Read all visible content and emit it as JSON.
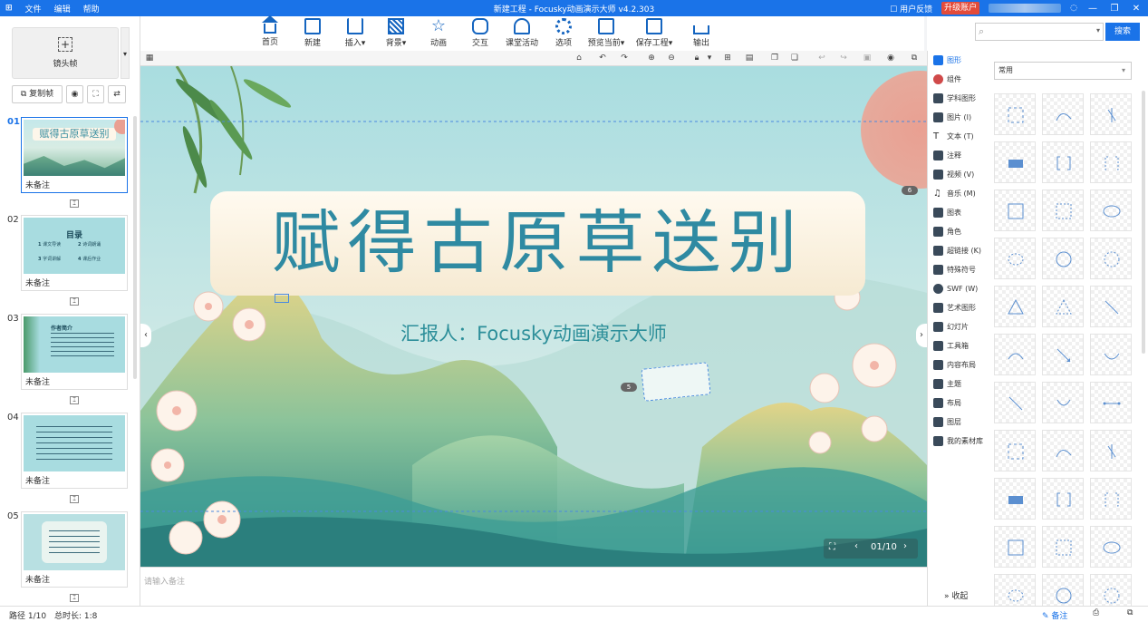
{
  "titlebar": {
    "menu": [
      "文件",
      "编辑",
      "帮助"
    ],
    "title": "新建工程 - Focusky动画演示大师  v4.2.303",
    "feedback": "用户反馈",
    "upgrade": "升级账户"
  },
  "toolbar": {
    "items": [
      "首页",
      "新建",
      "插入",
      "背景",
      "动画",
      "交互",
      "课堂活动",
      "选项",
      "预览当前",
      "保存工程",
      "输出"
    ]
  },
  "search": {
    "button": "搜索"
  },
  "left_panel": {
    "lens_label": "镜头帧",
    "copy_frame": "复制帧",
    "slides": [
      {
        "num": "01",
        "note": "未备注",
        "selected": true
      },
      {
        "num": "02",
        "note": "未备注"
      },
      {
        "num": "03",
        "note": "未备注"
      },
      {
        "num": "04",
        "note": "未备注"
      },
      {
        "num": "05",
        "note": "未备注"
      }
    ],
    "thumb2": {
      "title": "目录",
      "items": [
        "1",
        "课文导读",
        "2",
        "诗词朗诵",
        "3",
        "字词讲解",
        "4",
        "课后作业"
      ]
    },
    "thumb3": {
      "title": "作者简介"
    }
  },
  "stage": {
    "title": "赋得古原草送别",
    "subtitle": "汇报人：Focusky动画演示大师",
    "badge_a": "6",
    "badge_b": "5",
    "page": "01/10"
  },
  "notes": {
    "placeholder": "请输入备注"
  },
  "categories": [
    "图形",
    "组件",
    "学科图形",
    "图片 (I)",
    "文本 (T)",
    "注释",
    "视频 (V)",
    "音乐 (M)",
    "图表",
    "角色",
    "超链接 (K)",
    "特殊符号",
    "SWF (W)",
    "艺术图形",
    "幻灯片",
    "工具箱",
    "内容布局",
    "主题",
    "布局",
    "图层",
    "我的素材库"
  ],
  "collapse": "收起",
  "shapes_panel": {
    "filter": "常用"
  },
  "status": {
    "path": "路径 1/10",
    "duration": "总时长: 1:8",
    "note": "备注"
  }
}
